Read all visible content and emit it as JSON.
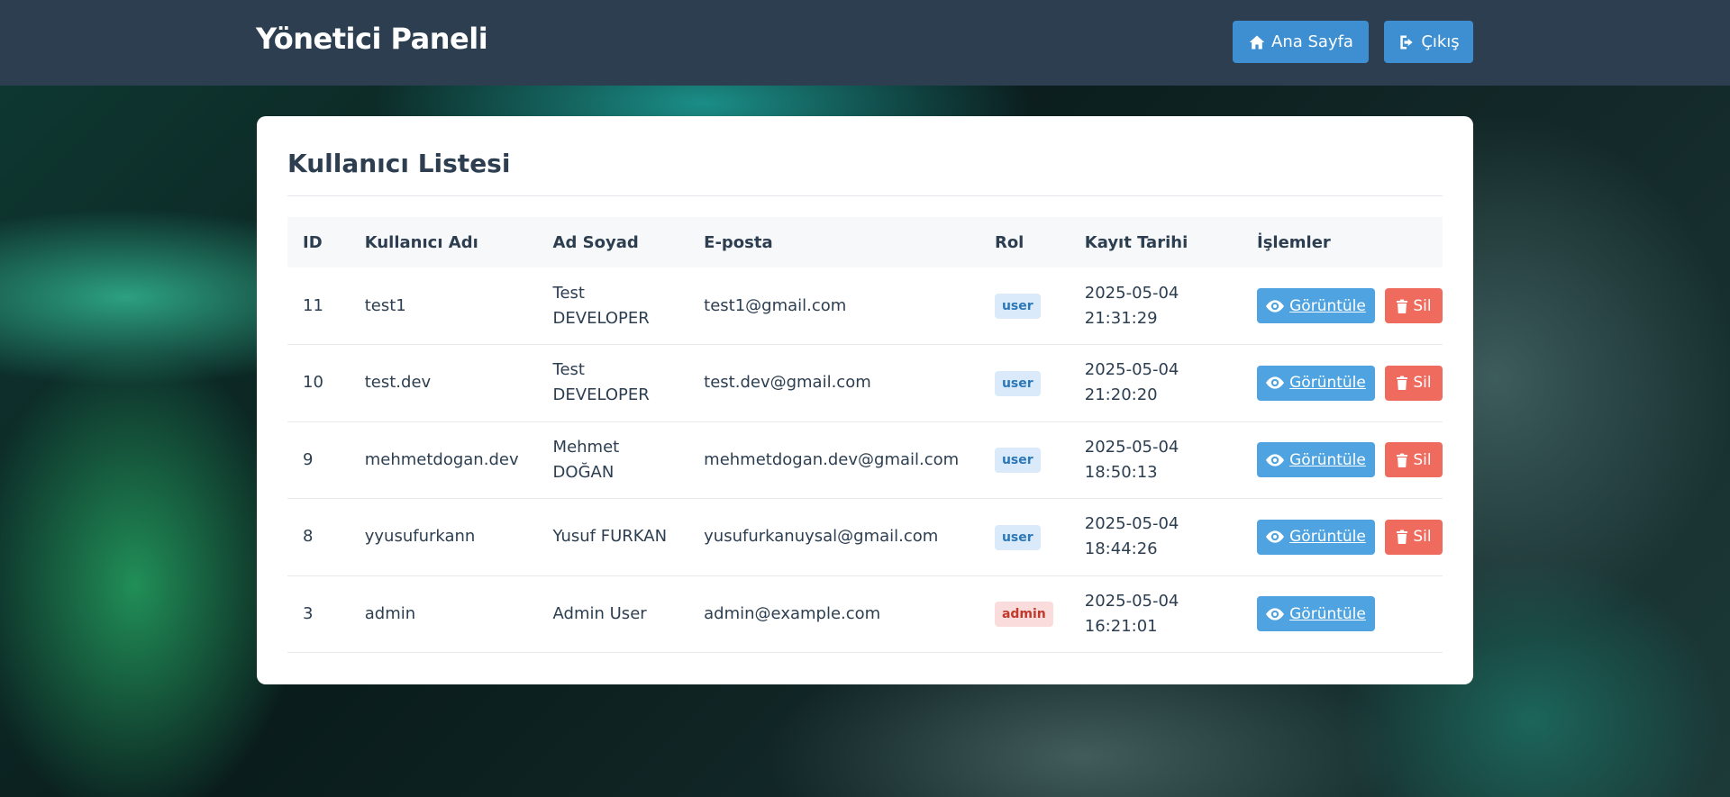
{
  "header": {
    "title": "Yönetici Paneli",
    "home_label": "Ana Sayfa",
    "logout_label": "Çıkış"
  },
  "card": {
    "title": "Kullanıcı Listesi"
  },
  "table": {
    "columns": [
      "ID",
      "Kullanıcı Adı",
      "Ad Soyad",
      "E-posta",
      "Rol",
      "Kayıt Tarihi",
      "İşlemler"
    ],
    "rows": [
      {
        "id": "11",
        "username": "test1",
        "name_first": "Test",
        "name_last": "DEVELOPER",
        "email": "test1@gmail.com",
        "role": "user",
        "date": "2025-05-04",
        "time": "21:31:29",
        "view": "Görüntüle",
        "delete": "Sil"
      },
      {
        "id": "10",
        "username": "test.dev",
        "name_first": "Test",
        "name_last": "DEVELOPER",
        "email": "test.dev@gmail.com",
        "role": "user",
        "date": "2025-05-04",
        "time": "21:20:20",
        "view": "Görüntüle",
        "delete": "Sil"
      },
      {
        "id": "9",
        "username": "mehmetdogan.dev",
        "name_first": "Mehmet",
        "name_last": "DOĞAN",
        "email": "mehmetdogan.dev@gmail.com",
        "role": "user",
        "date": "2025-05-04",
        "time": "18:50:13",
        "view": "Görüntüle",
        "delete": "Sil"
      },
      {
        "id": "8",
        "username": "yyusufurkann",
        "name_first": "Yusuf FURKAN",
        "name_last": "",
        "email": "yusufurkanuysal@gmail.com",
        "role": "user",
        "date": "2025-05-04",
        "time": "18:44:26",
        "view": "Görüntüle",
        "delete": "Sil"
      },
      {
        "id": "3",
        "username": "admin",
        "name_first": "Admin User",
        "name_last": "",
        "email": "admin@example.com",
        "role": "admin",
        "date": "2025-05-04",
        "time": "16:21:01",
        "view": "Görüntüle",
        "delete": ""
      }
    ]
  },
  "colors": {
    "topbar": "#2c3e50",
    "nav_button": "#3d8fd1",
    "view_button": "#4ea3e0",
    "delete_button": "#ee6b5e",
    "badge_user_bg": "#dbeafa",
    "badge_admin_bg": "#fadcdc"
  },
  "icons": {
    "home": "home-icon",
    "logout": "sign-out-icon",
    "view": "eye-icon",
    "delete": "trash-icon"
  }
}
